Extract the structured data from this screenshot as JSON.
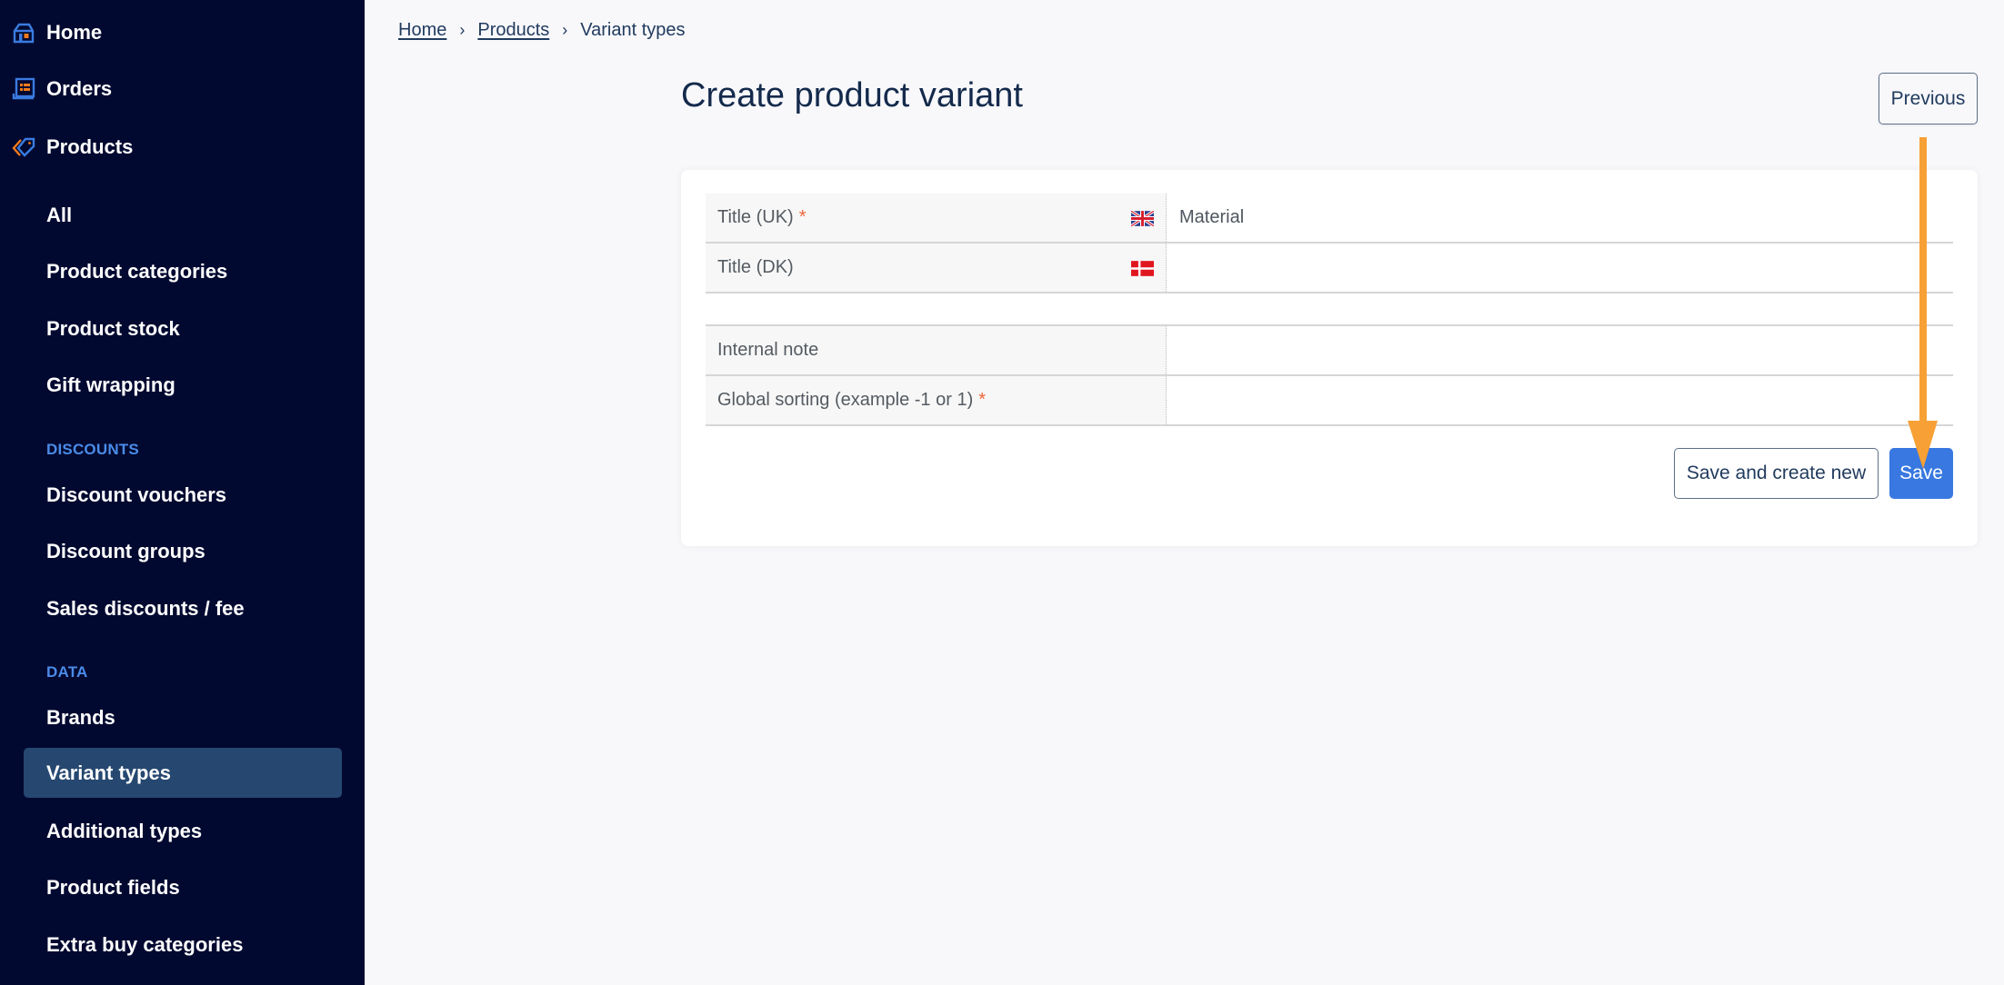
{
  "sidebar": {
    "top_items": [
      {
        "label": "Home",
        "icon": "home-icon"
      },
      {
        "label": "Orders",
        "icon": "orders-icon"
      },
      {
        "label": "Products",
        "icon": "tag-icon"
      }
    ],
    "product_items": [
      "All",
      "Product categories",
      "Product stock",
      "Gift wrapping"
    ],
    "discounts_heading": "DISCOUNTS",
    "discount_items": [
      "Discount vouchers",
      "Discount groups",
      "Sales discounts / fee"
    ],
    "data_heading": "DATA",
    "data_items": [
      "Brands",
      "Variant types",
      "Additional types",
      "Product fields",
      "Extra buy categories"
    ],
    "active_item": "Variant types"
  },
  "breadcrumb": {
    "items": [
      "Home",
      "Products",
      "Variant types"
    ],
    "separator": "›"
  },
  "page": {
    "title": "Create product variant",
    "previous_label": "Previous"
  },
  "form": {
    "fields": [
      {
        "label": "Title (UK)",
        "required": true,
        "flag": "uk-flag",
        "value": ""
      },
      {
        "label": "Title (DK)",
        "required": false,
        "flag": "dk-flag",
        "value": ""
      },
      {
        "label": "Internal note",
        "required": false,
        "value": ""
      },
      {
        "label": "Global sorting (example -1 or 1)",
        "required": true,
        "value": ""
      }
    ],
    "title_uk_value": "Material",
    "required_mark": "*",
    "save_and_new_label": "Save and create new",
    "save_label": "Save"
  },
  "annotation": {
    "type": "arrow",
    "color": "#f7a035",
    "points_to": "Save"
  },
  "colors": {
    "sidebar_bg": "#020930",
    "sidebar_active": "#264870",
    "section_heading": "#4a8be8",
    "primary": "#3878e0",
    "required": "#f0643a"
  }
}
